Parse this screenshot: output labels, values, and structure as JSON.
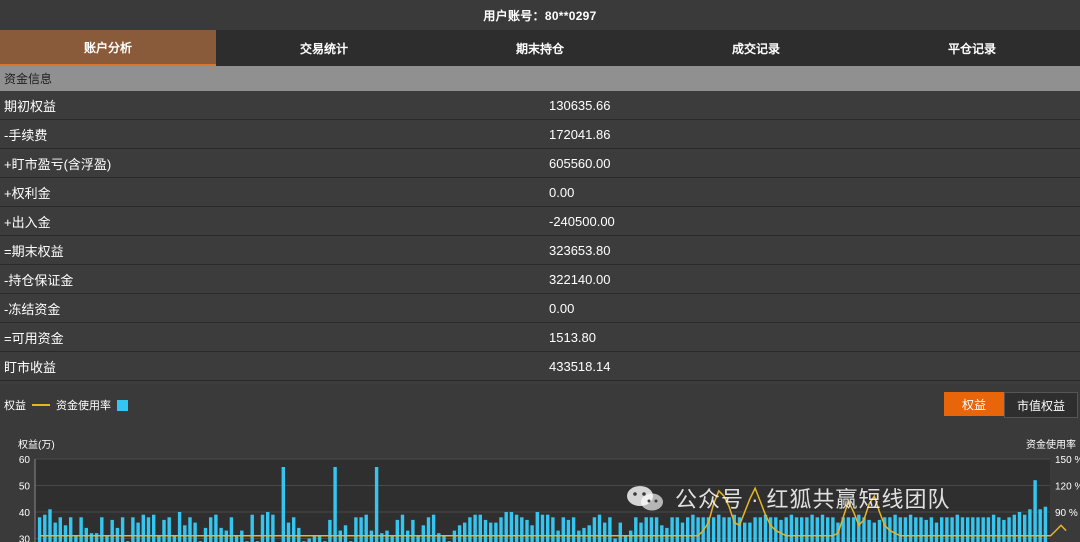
{
  "header": {
    "title": "用户账号：80**0297"
  },
  "tabs": [
    {
      "label": "账户分析",
      "active": true
    },
    {
      "label": "交易统计",
      "active": false
    },
    {
      "label": "期末持仓",
      "active": false
    },
    {
      "label": "成交记录",
      "active": false
    },
    {
      "label": "平仓记录",
      "active": false
    }
  ],
  "section": {
    "title": "资金信息"
  },
  "rows": [
    {
      "label": "期初权益",
      "value": "130635.66"
    },
    {
      "label": "-手续费",
      "value": "172041.86"
    },
    {
      "label": "+盯市盈亏(含浮盈)",
      "value": "605560.00"
    },
    {
      "label": "+权利金",
      "value": "0.00"
    },
    {
      "label": "+出入金",
      "value": "-240500.00"
    },
    {
      "label": "=期末权益",
      "value": "323653.80"
    },
    {
      "label": "-持仓保证金",
      "value": "322140.00"
    },
    {
      "label": "-冻结资金",
      "value": "0.00"
    },
    {
      "label": "=可用资金",
      "value": "1513.80"
    },
    {
      "label": "盯市收益",
      "value": "433518.14"
    }
  ],
  "chart_legend": {
    "line_label": "权益",
    "bar_label": "资金使用率"
  },
  "toggle": {
    "on": "权益",
    "off": "市值权益"
  },
  "colors": {
    "accent": "#e8650a",
    "bar": "#34c6f0",
    "line": "#e8b524",
    "active_tab": "#8a5b3b"
  },
  "chart_data": {
    "type": "bar",
    "ylabel_left": "权益(万)",
    "ylabel_right": "资金使用率",
    "left_ticks": [
      "60",
      "50",
      "40",
      "30"
    ],
    "right_ticks": [
      "150 %",
      "120 %",
      "90 %"
    ],
    "ylim_left": [
      30,
      60
    ],
    "series": [
      {
        "name": "资金使用率",
        "values": [
          38,
          39,
          41,
          36,
          38,
          35,
          38,
          31,
          38,
          34,
          32,
          32,
          38,
          31,
          37,
          34,
          38,
          29,
          38,
          36,
          39,
          38,
          39,
          31,
          37,
          38,
          31,
          40,
          35,
          38,
          36,
          29,
          34,
          38,
          39,
          34,
          33,
          38,
          31,
          33,
          29,
          39,
          29,
          39,
          40,
          39,
          28,
          57,
          36,
          38,
          34,
          29,
          30,
          31,
          31,
          29,
          37,
          57,
          33,
          35,
          29,
          38,
          38,
          39,
          33,
          57,
          32,
          33,
          31,
          37,
          39,
          33,
          37,
          31,
          35,
          38,
          39,
          32,
          31,
          29,
          33,
          35,
          36,
          38,
          39,
          39,
          37,
          36,
          36,
          38,
          40,
          40,
          39,
          38,
          37,
          35,
          40,
          39,
          39,
          38,
          33,
          38,
          37,
          38,
          33,
          34,
          35,
          38,
          39,
          36,
          38,
          30,
          36,
          31,
          33,
          38,
          36,
          38,
          38,
          38,
          35,
          34,
          38,
          38,
          36,
          38,
          39,
          38,
          38,
          38,
          38,
          39,
          38,
          38,
          39,
          38,
          36,
          36,
          38,
          38,
          39,
          38,
          38,
          37,
          38,
          39,
          38,
          38,
          38,
          39,
          38,
          39,
          38,
          38,
          36,
          38,
          38,
          38,
          39,
          38,
          37,
          36,
          37,
          38,
          38,
          39,
          38,
          38,
          39,
          38,
          38,
          37,
          38,
          36,
          38,
          38,
          38,
          39,
          38,
          38,
          38,
          38,
          38,
          38,
          39,
          38,
          37,
          38,
          39,
          40,
          39,
          41,
          52,
          41,
          42
        ]
      },
      {
        "name": "权益",
        "values": [
          31,
          31,
          31,
          31,
          31,
          31,
          31,
          31,
          31,
          31,
          31,
          31,
          31,
          31,
          31,
          31,
          31,
          31,
          31,
          31,
          31,
          31,
          31,
          31,
          31,
          31,
          31,
          31,
          31,
          31,
          31,
          31,
          31,
          31,
          31,
          31,
          31,
          31,
          31,
          31,
          31,
          31,
          31,
          31,
          31,
          31,
          31,
          31,
          31,
          31,
          31,
          31,
          31,
          31,
          31,
          31,
          31,
          31,
          31,
          31,
          31,
          31,
          31,
          31,
          31,
          31,
          31,
          31,
          31,
          31,
          31,
          31,
          31,
          31,
          31,
          31,
          31,
          31,
          31,
          31,
          31,
          31,
          31,
          31,
          31,
          31,
          31,
          31,
          31,
          31,
          31,
          31,
          31,
          31,
          31,
          31,
          31,
          31,
          31,
          31,
          31,
          31,
          31,
          31,
          31,
          31,
          31,
          31,
          31,
          31,
          31,
          31,
          31,
          31,
          31,
          31,
          31,
          31,
          31,
          31,
          31,
          31,
          31,
          31,
          31,
          31,
          31,
          31,
          33,
          36,
          43,
          48,
          46,
          42,
          36,
          35,
          40,
          45,
          49,
          44,
          39,
          35,
          33,
          32,
          31,
          31,
          31,
          31,
          31,
          31,
          31,
          31,
          31,
          31,
          32,
          38,
          44,
          40,
          35,
          37,
          43,
          46,
          40,
          35,
          33,
          32,
          31,
          31,
          31,
          31,
          31,
          31,
          31,
          31,
          31,
          31,
          31,
          31,
          31,
          31,
          31,
          31,
          31,
          31,
          31,
          31,
          31,
          31,
          31,
          31,
          31,
          31,
          31,
          31,
          31,
          31,
          33,
          35,
          33
        ]
      }
    ]
  },
  "watermark": {
    "text": "公众号 · 红狐共赢短线团队"
  }
}
